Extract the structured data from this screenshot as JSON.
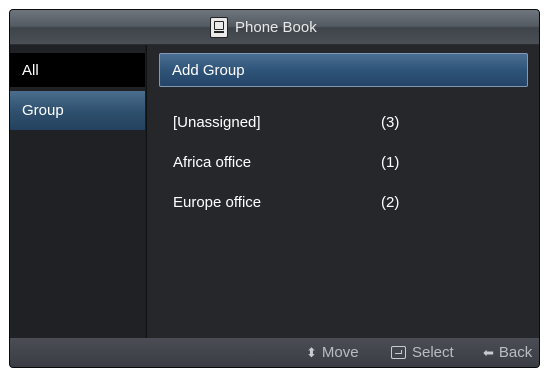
{
  "window": {
    "title": "Phone Book",
    "icon": "phone-book-icon"
  },
  "sidebar": {
    "items": [
      {
        "label": "All"
      },
      {
        "label": "Group",
        "selected": true
      }
    ]
  },
  "content": {
    "add_group_label": "Add Group",
    "groups": [
      {
        "name": "[Unassigned]",
        "count": "(3)"
      },
      {
        "name": "Africa office",
        "count": "(1)"
      },
      {
        "name": "Europe office",
        "count": "(2)"
      }
    ]
  },
  "footer": {
    "move": {
      "icon": "up-down-arrows-icon",
      "label": "Move"
    },
    "select": {
      "icon": "enter-icon",
      "label": "Select"
    },
    "back": {
      "icon": "left-arrow-icon",
      "label": "Back"
    }
  },
  "colors": {
    "accent": "#2f5479",
    "background": "#1c1d1f"
  }
}
